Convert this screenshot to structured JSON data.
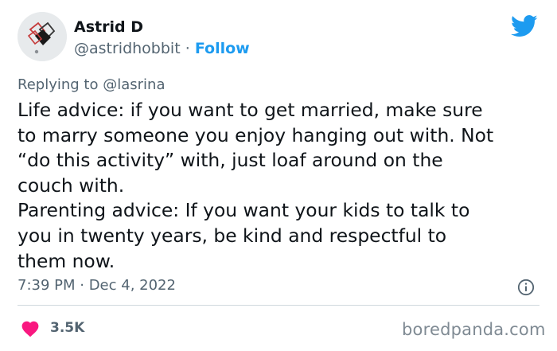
{
  "tweet": {
    "author_name": "Astrid D",
    "handle": "@astridhobbit",
    "separator": "·",
    "follow_label": "Follow",
    "replying_prefix": "Replying to",
    "replying_to": "@lasrina",
    "lines": [
      "Life advice: if you want to get married, make sure",
      "to marry someone you enjoy hanging out with. Not",
      "“do this activity” with, just loaf around on the",
      "couch with.",
      "Parenting advice: If you want your kids to talk to",
      "you in twenty years, be kind and respectful to",
      "them now."
    ],
    "timestamp": "7:39 PM · Dec 4, 2022",
    "likes": "3.5K"
  },
  "watermark": "boredpanda.com",
  "icons": {
    "brand": "twitter-bird-icon",
    "info": "info-icon",
    "like": "heart-icon"
  },
  "colors": {
    "accent": "#1d9bf0",
    "heart": "#f91880",
    "secondary_text": "#536471"
  }
}
